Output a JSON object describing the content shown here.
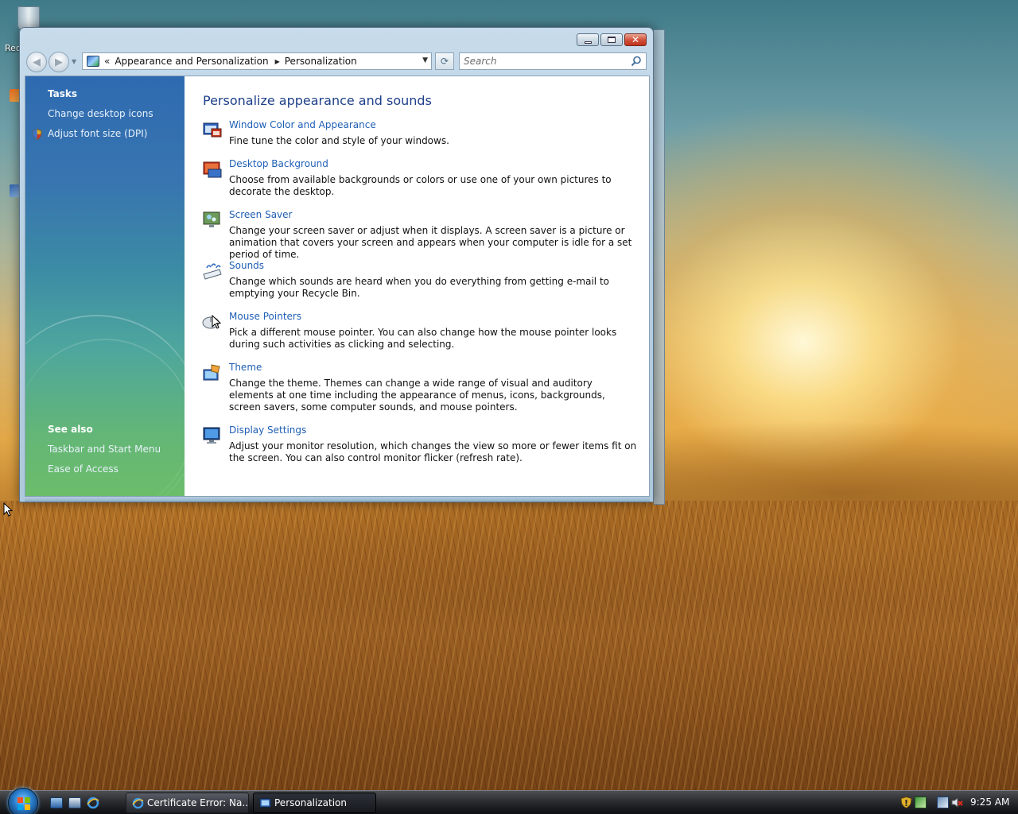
{
  "desktop": {
    "recycle_bin_label": "Rec"
  },
  "window": {
    "address": {
      "chevron": "«",
      "crumbs": [
        "Appearance and Personalization",
        "Personalization"
      ]
    },
    "search": {
      "placeholder": "Search"
    },
    "left_pane": {
      "tasks_heading": "Tasks",
      "tasks": [
        {
          "label": "Change desktop icons"
        },
        {
          "label": "Adjust font size (DPI)"
        }
      ],
      "see_also_heading": "See also",
      "see_also": [
        {
          "label": "Taskbar and Start Menu"
        },
        {
          "label": "Ease of Access"
        }
      ]
    },
    "main": {
      "title": "Personalize appearance and sounds",
      "items": [
        {
          "title": "Window Color and Appearance",
          "description": "Fine tune the color and style of your windows.",
          "icon": "window-color-icon"
        },
        {
          "title": "Desktop Background",
          "description": "Choose from available backgrounds or colors or use one of your own pictures to decorate the desktop.",
          "icon": "desktop-background-icon"
        },
        {
          "title": "Screen Saver",
          "description": "Change your screen saver or adjust when it displays. A screen saver is a picture or animation that covers your screen and appears when your computer is idle for a set period of time.",
          "icon": "screen-saver-icon"
        },
        {
          "title": "Sounds",
          "description": "Change which sounds are heard when you do everything from getting e-mail to emptying your Recycle Bin.",
          "icon": "sounds-icon"
        },
        {
          "title": "Mouse Pointers",
          "description": "Pick a different mouse pointer. You can also change how the mouse pointer looks during such activities as clicking and selecting.",
          "icon": "mouse-pointers-icon"
        },
        {
          "title": "Theme",
          "description": "Change the theme. Themes can change a wide range of visual and auditory elements at one time including the appearance of menus, icons, backgrounds, screen savers, some computer sounds, and mouse pointers.",
          "icon": "theme-icon"
        },
        {
          "title": "Display Settings",
          "description": "Adjust your monitor resolution, which changes the view so more or fewer items fit on the screen. You can also control monitor flicker (refresh rate).",
          "icon": "display-settings-icon"
        }
      ]
    }
  },
  "taskbar": {
    "buttons": [
      {
        "label": "Certificate Error: Na..."
      },
      {
        "label": "Personalization"
      }
    ],
    "clock": "9:25 AM"
  },
  "colors": {
    "link": "#1f5fb5",
    "title": "#1e3f8a",
    "left_pane_top": "#2e6ab0",
    "left_pane_bottom": "#6cbd6a"
  }
}
